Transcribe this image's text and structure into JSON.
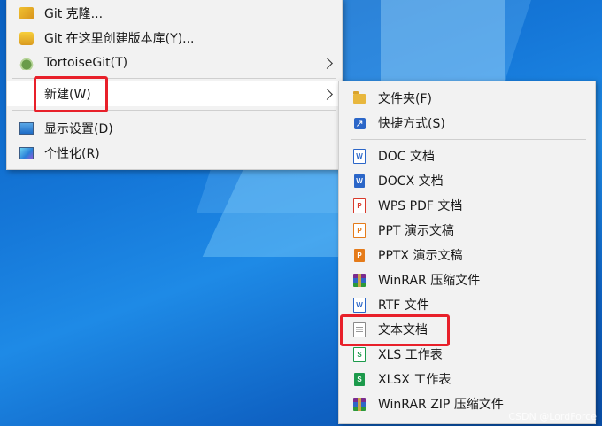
{
  "context_menu": {
    "items": [
      {
        "label": "Git 克隆...",
        "icon": "git-clone-icon"
      },
      {
        "label": "Git 在这里创建版本库(Y)...",
        "icon": "git-repo-icon"
      },
      {
        "label": "TortoiseGit(T)",
        "icon": "tortoisegit-icon",
        "has_submenu": true
      },
      {
        "label": "新建(W)",
        "icon": "none",
        "has_submenu": true,
        "highlighted": true
      },
      {
        "label": "显示设置(D)",
        "icon": "display-settings-icon"
      },
      {
        "label": "个性化(R)",
        "icon": "personalize-icon"
      }
    ]
  },
  "new_submenu": {
    "items": [
      {
        "label": "文件夹(F)",
        "icon": "folder-icon"
      },
      {
        "label": "快捷方式(S)",
        "icon": "shortcut-icon"
      },
      {
        "label": "DOC 文档",
        "icon": "doc-icon"
      },
      {
        "label": "DOCX 文档",
        "icon": "docx-icon"
      },
      {
        "label": "WPS PDF 文档",
        "icon": "pdf-icon"
      },
      {
        "label": "PPT 演示文稿",
        "icon": "ppt-icon"
      },
      {
        "label": "PPTX 演示文稿",
        "icon": "pptx-icon"
      },
      {
        "label": "WinRAR 压缩文件",
        "icon": "winrar-icon"
      },
      {
        "label": "RTF 文件",
        "icon": "rtf-icon"
      },
      {
        "label": "文本文档",
        "icon": "text-document-icon",
        "highlighted": true
      },
      {
        "label": "XLS 工作表",
        "icon": "xls-icon"
      },
      {
        "label": "XLSX 工作表",
        "icon": "xlsx-icon"
      },
      {
        "label": "WinRAR ZIP 压缩文件",
        "icon": "winrar-zip-icon"
      }
    ]
  },
  "watermark": "CSDN @LordForce",
  "colors": {
    "menu_bg": "#f2f2f2",
    "highlight_box": "#e8202a",
    "desktop_blue": "#1577d8"
  }
}
